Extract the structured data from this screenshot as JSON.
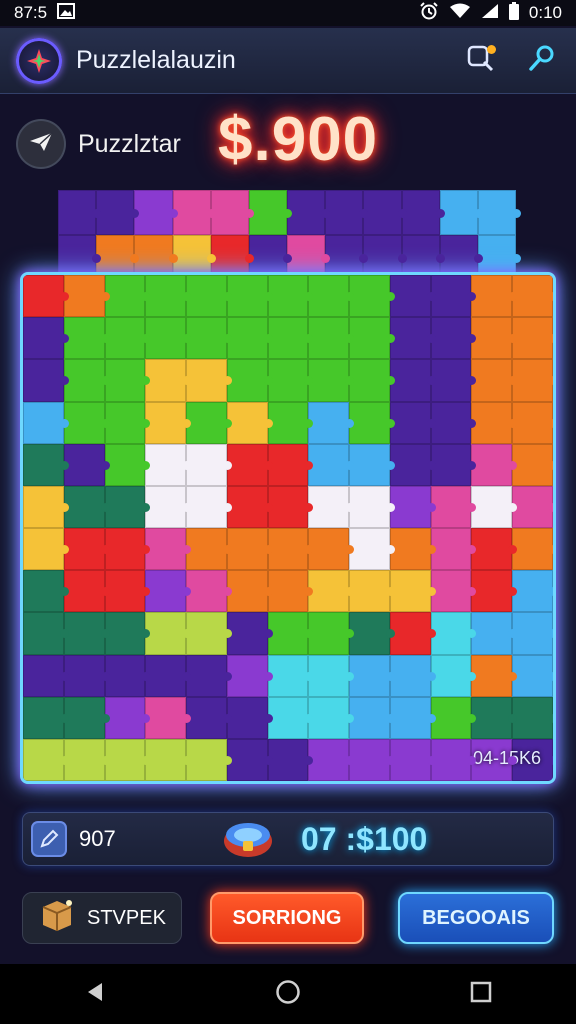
{
  "status_bar": {
    "left_text": "87:5",
    "time": "0:10",
    "icons": [
      "gallery-icon",
      "alarm-icon",
      "wifi-icon",
      "signal-icon",
      "battery-icon"
    ]
  },
  "app_bar": {
    "title": "Puzzlelalauzin",
    "actions": [
      "search-icon",
      "magnifier-icon"
    ]
  },
  "player": {
    "name": "Puzzlztar",
    "score": "$.900"
  },
  "board": {
    "timer_label": "04-15K6",
    "palette": {
      "G": "#46c82a",
      "R": "#e8282a",
      "O": "#f07a20",
      "Y": "#f5c238",
      "P": "#4a249c",
      "M": "#8a3ad0",
      "B": "#46b0f0",
      "C": "#4ad8e8",
      "W": "#f4f0f8",
      "K": "#e04aa0",
      "D": "#1f7a5a",
      "L": "#b8d848"
    },
    "back_rows": [
      "PPMKKGPPPPBB",
      "POOYRPKPPPPB"
    ],
    "rows": [
      "ROGGGGGGGPPOO",
      "PGGGGGGGGPPOO",
      "PGGYYGGGGPPOO",
      "BGGYGYGBGPPOO",
      "DPGWWRRBBPPKO",
      "YDDWWRRWWMKWK",
      "YRRKOOOOWOKRO",
      "DRRMKOOYYYKRB",
      "DDDLLPGGDRCBB",
      "PPPPPMCCBBCOB",
      "DDMKPPCCBBGDD",
      "LLLLLPPMMMMMP"
    ]
  },
  "stats": {
    "moves": "907",
    "timer_score": "07 :$100"
  },
  "buttons": {
    "shop_label": "STVPEK",
    "sort_label": "SORRIONG",
    "begin_label": "BEGOOAIS"
  },
  "nav_bar": [
    "back-icon",
    "home-icon",
    "recents-icon"
  ]
}
